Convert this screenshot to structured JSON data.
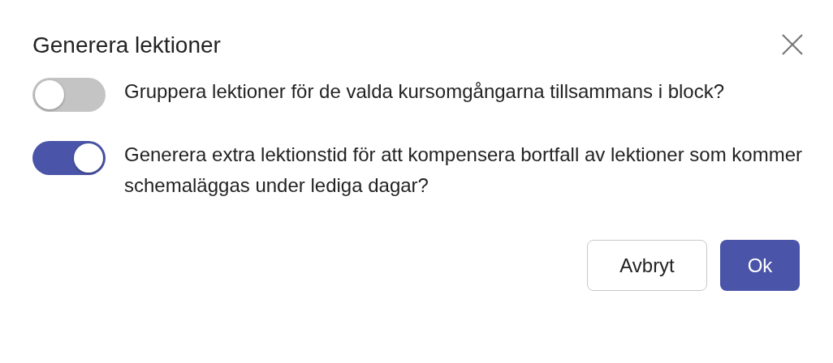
{
  "dialog": {
    "title": "Generera lektioner"
  },
  "options": [
    {
      "label": "Gruppera lektioner för de valda kursomgångarna tillsammans i block?",
      "on": false
    },
    {
      "label": "Generera extra lektionstid för att kompensera bortfall av lektioner som kommer schemaläggas under lediga dagar?",
      "on": true
    }
  ],
  "buttons": [
    {
      "label": "Avbryt",
      "kind": "secondary"
    },
    {
      "label": "Ok",
      "kind": "primary"
    }
  ]
}
